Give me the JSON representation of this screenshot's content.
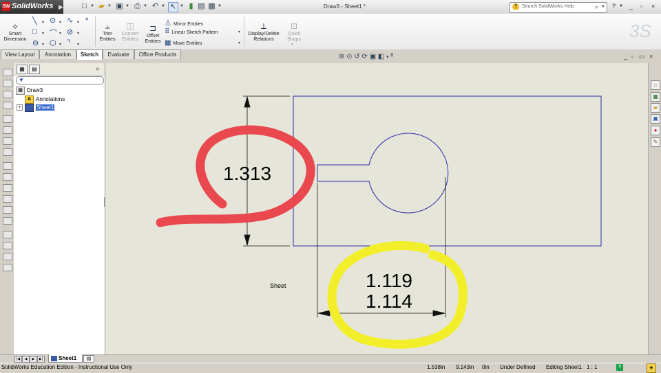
{
  "app": {
    "name": "SolidWorks",
    "document_title": "Draw3 - Sheet1 *",
    "search_placeholder": "Search SolidWorks Help"
  },
  "window_controls": {
    "help": "?",
    "minimize": "_",
    "restore": "▫",
    "close": "×"
  },
  "commands": {
    "smart_dimension": "Smart\nDimension",
    "trim_entities": "Trim\nEntities",
    "convert_entities": "Convert\nEntities",
    "offset_entities": "Offset\nEntities",
    "mirror_entities": "Mirror Entities",
    "linear_sketch_pattern": "Linear Sketch Pattern",
    "move_entities": "Move Entities",
    "display_delete_relations": "Display/Delete\nRelations",
    "quick_snaps": "Quick\nSnaps"
  },
  "tabs": [
    {
      "label": "View Layout"
    },
    {
      "label": "Annotation"
    },
    {
      "label": "Sketch",
      "active": true
    },
    {
      "label": "Evaluate"
    },
    {
      "label": "Office Products"
    }
  ],
  "feature_tree": {
    "root": "Draw3",
    "annotations": "Annotations",
    "sheet": "Sheet1"
  },
  "drawing": {
    "sheet_label": "Sheet",
    "dim_vertical": "1.313",
    "dim_horizontal_1": "1.119",
    "dim_horizontal_2": "1.114",
    "line_color": "#2a2aa8",
    "markup_red": "#e8484e",
    "markup_yellow": "#f2ee2a"
  },
  "sheet_tabs": {
    "active": "Sheet1"
  },
  "status_bar": {
    "edition": "SolidWorks Education Edition - Instructional Use Only",
    "x": "1.538in",
    "y": "9.143in",
    "z": "0in",
    "state": "Under Defined",
    "editing": "Editing Sheet1",
    "scale": "1 : 1"
  }
}
